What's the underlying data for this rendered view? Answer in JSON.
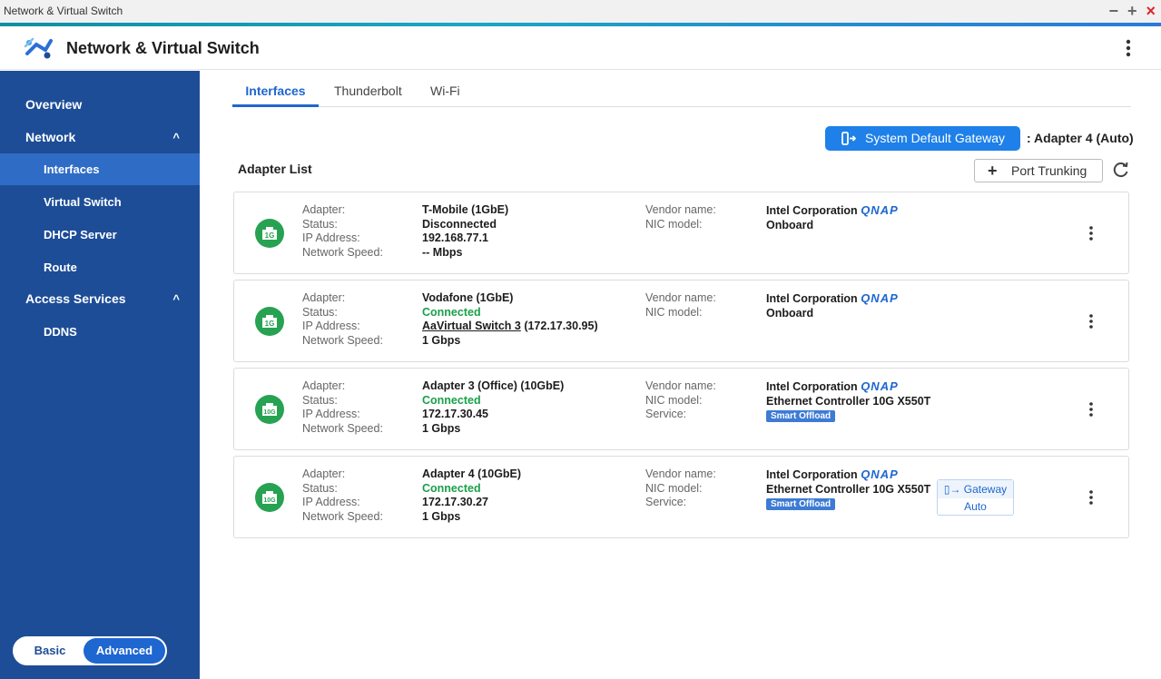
{
  "window": {
    "title": "Network & Virtual Switch",
    "minimize": "−",
    "maximize": "+",
    "close": "×"
  },
  "app": {
    "title": "Network & Virtual Switch"
  },
  "sidebar": {
    "overview": "Overview",
    "network": "Network",
    "network_items": [
      "Interfaces",
      "Virtual Switch",
      "DHCP Server",
      "Route"
    ],
    "access_services": "Access Services",
    "access_items": [
      "DDNS"
    ],
    "caret": "^",
    "mode": {
      "basic": "Basic",
      "advanced": "Advanced"
    }
  },
  "tabs": [
    "Interfaces",
    "Thunderbolt",
    "Wi-Fi"
  ],
  "gateway": {
    "button_label": "System Default Gateway",
    "value": ": Adapter 4 (Auto)"
  },
  "adapter_list": {
    "title": "Adapter List",
    "port_trunking": "Port Trunking"
  },
  "labels": {
    "adapter": "Adapter:",
    "status": "Status:",
    "ip": "IP Address:",
    "speed": "Network Speed:",
    "vendor": "Vendor name:",
    "nic": "NIC model:",
    "service": "Service:"
  },
  "adapters": [
    {
      "icon_text": "1G",
      "adapter": "T-Mobile (1GbE)",
      "status": "Disconnected",
      "ip": "192.168.77.1",
      "speed": "-- Mbps",
      "vendor": "Intel Corporation",
      "vendor_logo": "QNAP",
      "nic": "Onboard"
    },
    {
      "icon_text": "1G",
      "adapter": "Vodafone (1GbE)",
      "status": "Connected",
      "ip_link": "AaVirtual Switch 3",
      "ip": " (172.17.30.95)",
      "speed": "1 Gbps",
      "vendor": "Intel Corporation",
      "vendor_logo": "QNAP",
      "nic": "Onboard"
    },
    {
      "icon_text": "10G",
      "adapter": "Adapter 3 (Office) (10GbE)",
      "status": "Connected",
      "ip": "172.17.30.45",
      "speed": "1 Gbps",
      "vendor": "Intel Corporation",
      "vendor_logo": "QNAP",
      "nic": "Ethernet Controller 10G X550T",
      "service": "Smart Offload"
    },
    {
      "icon_text": "10G",
      "adapter": "Adapter 4 (10GbE)",
      "status": "Connected",
      "ip": "172.17.30.27",
      "speed": "1 Gbps",
      "vendor": "Intel Corporation",
      "vendor_logo": "QNAP",
      "nic": "Ethernet Controller 10G X550T",
      "service": "Smart Offload",
      "gateway_tag": "Gateway",
      "gateway_mode": "Auto"
    }
  ],
  "colors": {
    "sidebar": "#1d4d97",
    "accent": "#1e66d0",
    "connected": "#1aa04a",
    "nic_icon": "#27a252"
  }
}
